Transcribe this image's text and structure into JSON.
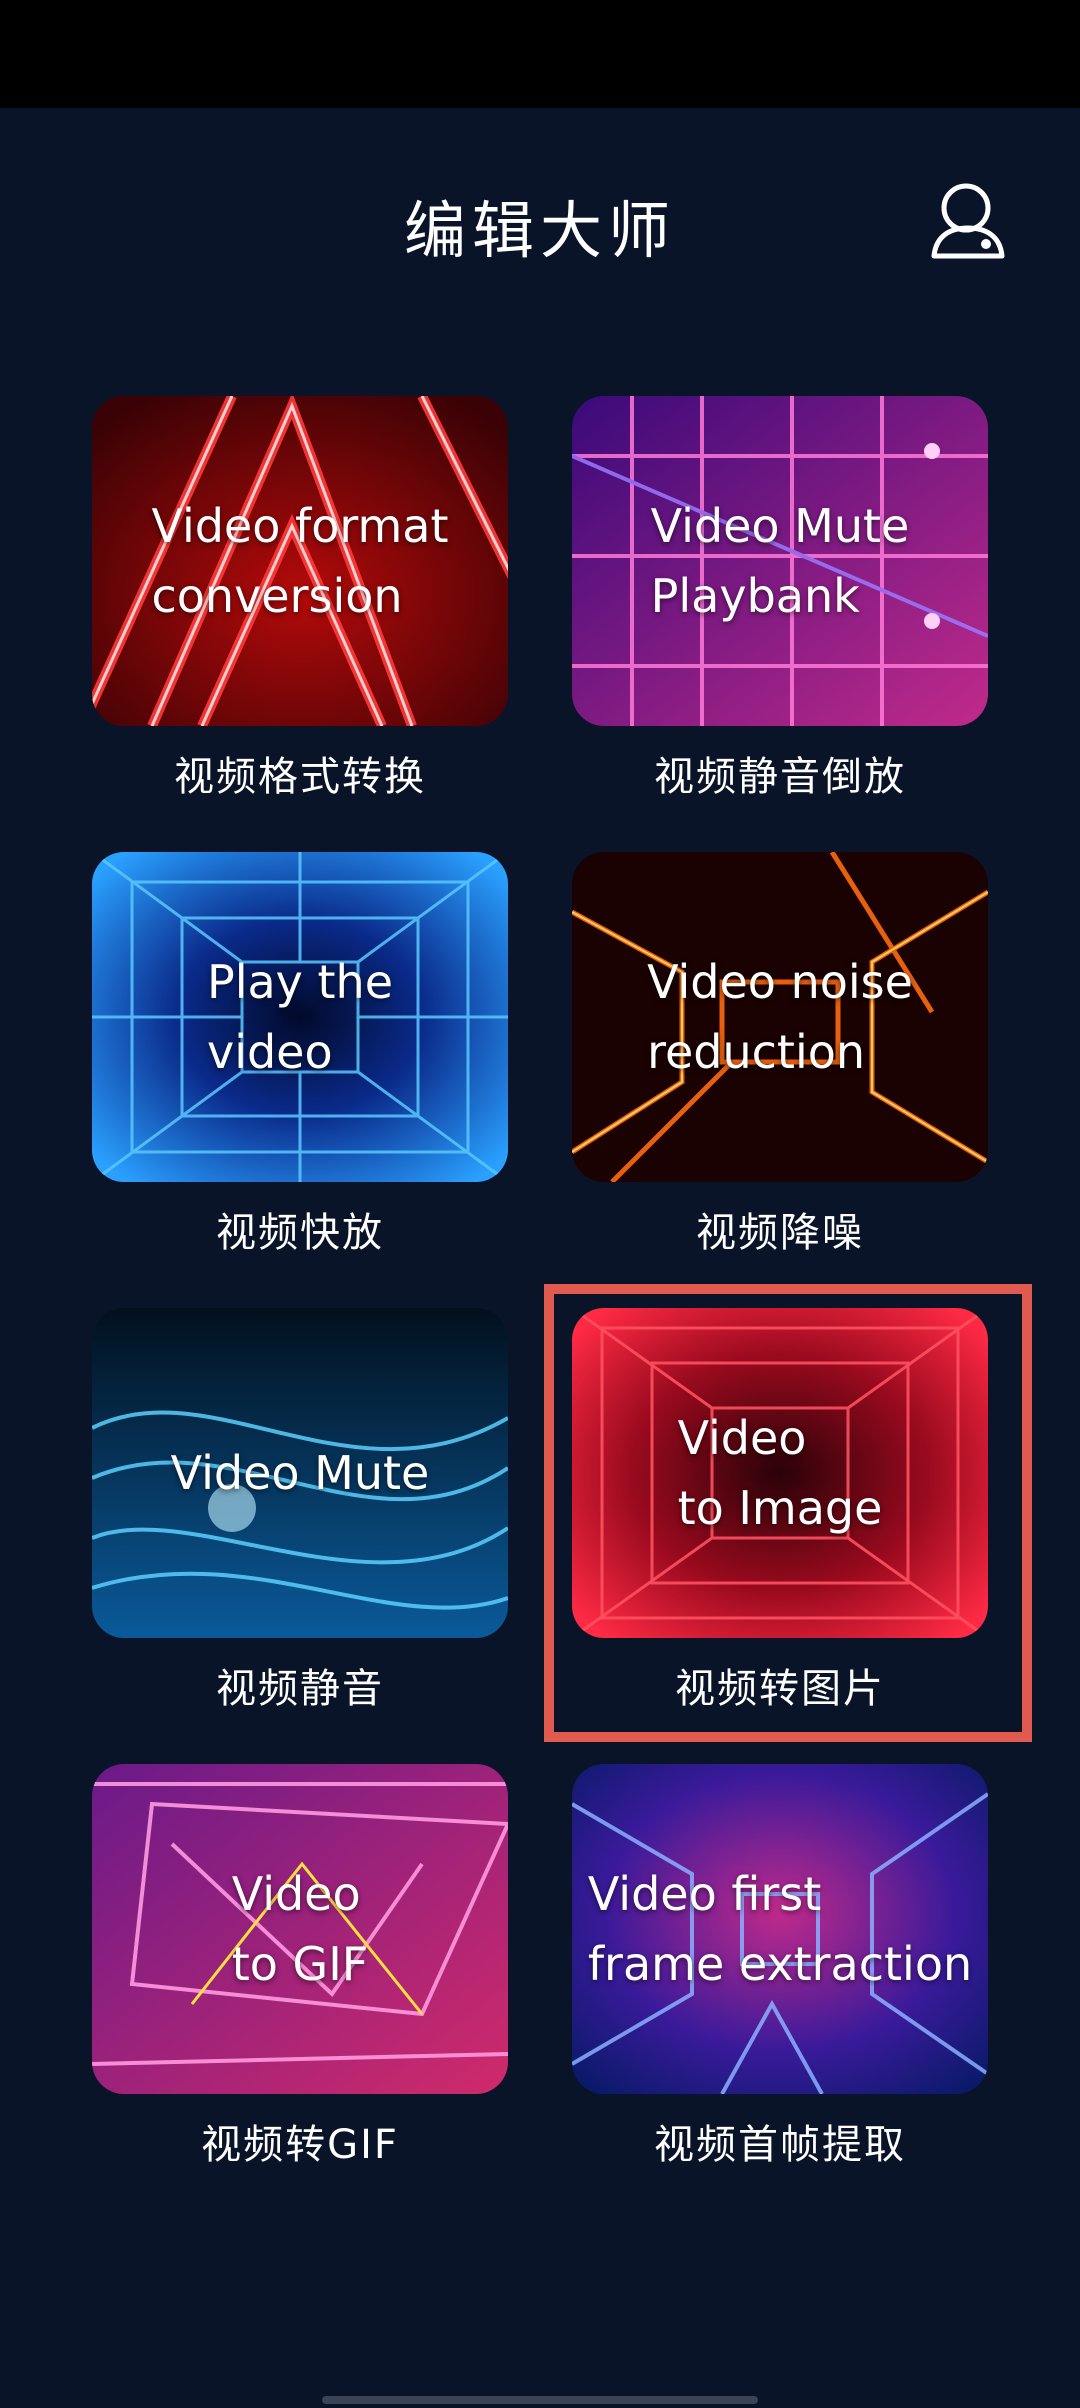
{
  "header": {
    "title": "编辑大师",
    "profile_icon": "user-icon"
  },
  "tiles": [
    {
      "caption": "视频格式转换",
      "overlay": "Video format\nconversion",
      "theme": "red-triangles"
    },
    {
      "caption": "视频静音倒放",
      "overlay": "Video Mute\nPlaybank",
      "theme": "purple-grid"
    },
    {
      "caption": "视频快放",
      "overlay": "Play the\nvideo",
      "theme": "blue-grid"
    },
    {
      "caption": "视频降噪",
      "overlay": "Video noise\nreduction",
      "theme": "orange-tunnel"
    },
    {
      "caption": "视频静音",
      "overlay": "Video Mute",
      "theme": "blue-waves"
    },
    {
      "caption": "视频转图片",
      "overlay": "Video\nto Image",
      "theme": "red-grid"
    },
    {
      "caption": "视频转GIF",
      "overlay": "Video\nto GIF",
      "theme": "pink-tunnel"
    },
    {
      "caption": "视频首帧提取",
      "overlay": "Video first\nframe extraction",
      "theme": "violet-tunnel"
    }
  ],
  "selected_tile": "视频转图片",
  "colors": {
    "background": "#0a1428",
    "selection": "#e05a50"
  }
}
